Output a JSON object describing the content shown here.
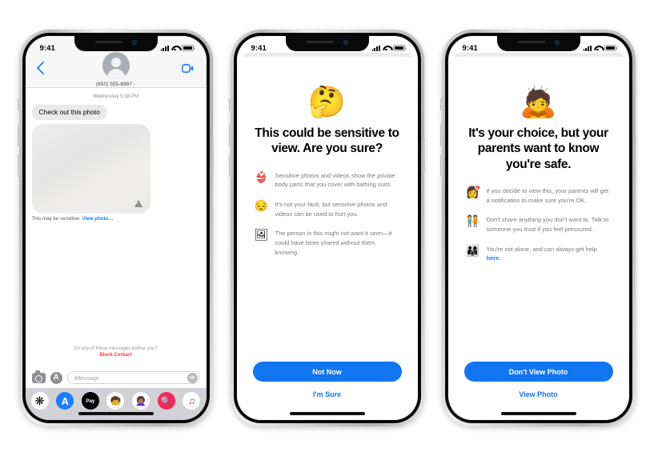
{
  "phones": [
    {
      "id": "messages",
      "status": {
        "time": "9:41",
        "signal_icon": "cellular-bars-icon",
        "wifi_icon": "wifi-icon",
        "battery_icon": "battery-icon"
      },
      "header": {
        "back_icon": "back-chevron-icon",
        "facetime_icon": "facetime-video-icon",
        "avatar_icon": "contact-avatar-icon",
        "contact": "(650) 555-8997",
        "contact_chevron": "›"
      },
      "conversation": {
        "timestamp": "Wednesday 5:38 PM",
        "message": "Check out this photo",
        "photo_warning_icon": "warning-triangle-icon",
        "sensitive_prefix": "This may be sensitive.",
        "view_photo_link": "View photo…",
        "bother_question": "Do any of these messages bother you?",
        "block_contact": "Block Contact"
      },
      "compose": {
        "camera_icon": "camera-icon",
        "appstore_icon": "app-store-icon",
        "placeholder": "iMessage",
        "mic_icon": "audio-waveform-icon"
      },
      "dock": [
        {
          "name": "photos-app-icon",
          "glyph": "❋"
        },
        {
          "name": "app-store-app-icon",
          "glyph": "A"
        },
        {
          "name": "apple-pay-app-icon",
          "glyph": "Pay"
        },
        {
          "name": "memoji-app-icon",
          "glyph": "🧒"
        },
        {
          "name": "memoji-stickers-app-icon",
          "glyph": "👩🏽‍🦱"
        },
        {
          "name": "images-app-icon",
          "glyph": "🔍"
        },
        {
          "name": "music-app-icon",
          "glyph": "♫"
        }
      ]
    },
    {
      "id": "sensitive-warning",
      "status": {
        "time": "9:41"
      },
      "hero_emoji": "🤔",
      "hero_emoji_name": "thinking-face-emoji",
      "title": "This could be sensitive to view. Are you sure?",
      "bullets": [
        {
          "icon": "👙",
          "icon_name": "swimsuit-emoji",
          "text": "Sensitive photos and videos show the private body parts that you cover with bathing suits."
        },
        {
          "icon": "😔",
          "icon_name": "pensive-face-emoji",
          "text": "It's not your fault, but sensitive photos and videos can be used to hurt you."
        },
        {
          "icon": "🖼",
          "icon_name": "framed-picture-emoji",
          "text": "The person in this might not want it seen—it could have been shared without them knowing."
        }
      ],
      "primary_button": "Not Now",
      "secondary_button": "I'm Sure"
    },
    {
      "id": "parents-notified",
      "status": {
        "time": "9:41"
      },
      "hero_emoji": "🙇",
      "hero_emoji_name": "person-bowing-emoji",
      "title": "It's your choice, but your parents want to know you're safe.",
      "bullets": [
        {
          "icon": "👩",
          "icon_name": "parent-notification-avatar-emoji",
          "badge": "1",
          "text": "If you decide to view this, your parents will get a notification to make sure you're OK."
        },
        {
          "icon": "🧑‍🤝‍🧑",
          "icon_name": "talk-to-someone-emoji",
          "text": "Don't share anything you don't want to. Talk to someone you trust if you feel pressured."
        },
        {
          "icon": "👨‍👩‍👧",
          "icon_name": "family-support-emoji",
          "text": "You're not alone, and can always get help",
          "link": "here."
        }
      ],
      "primary_button": "Don't View Photo",
      "secondary_button": "View Photo"
    }
  ],
  "colors": {
    "accent_blue": "#1275f0",
    "link_blue": "#1e7eff",
    "danger_red": "#ff3b30",
    "bubble_gray": "#e9e9eb"
  }
}
